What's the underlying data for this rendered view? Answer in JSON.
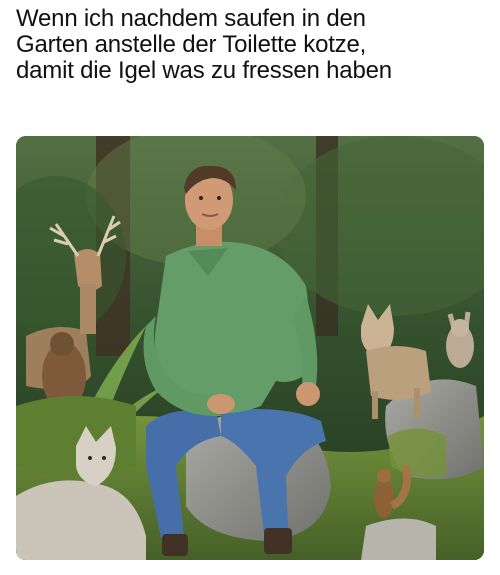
{
  "meme": {
    "caption_lines": [
      "Wenn ich nachdem saufen in den",
      "Garten anstelle der Toilette kotze,",
      "damit die Igel was zu fressen haben"
    ]
  },
  "photo": {
    "subjects": [
      "man-in-green-shirt",
      "deer",
      "coyote",
      "wolf",
      "rabbit",
      "marmot",
      "squirrel"
    ],
    "colors": {
      "forest_dark": "#1f3a1c",
      "shirt": "#5f9a62",
      "jeans": "#3f6aa6",
      "rock": "#8c8c88",
      "moss": "#6d8f2f"
    }
  }
}
